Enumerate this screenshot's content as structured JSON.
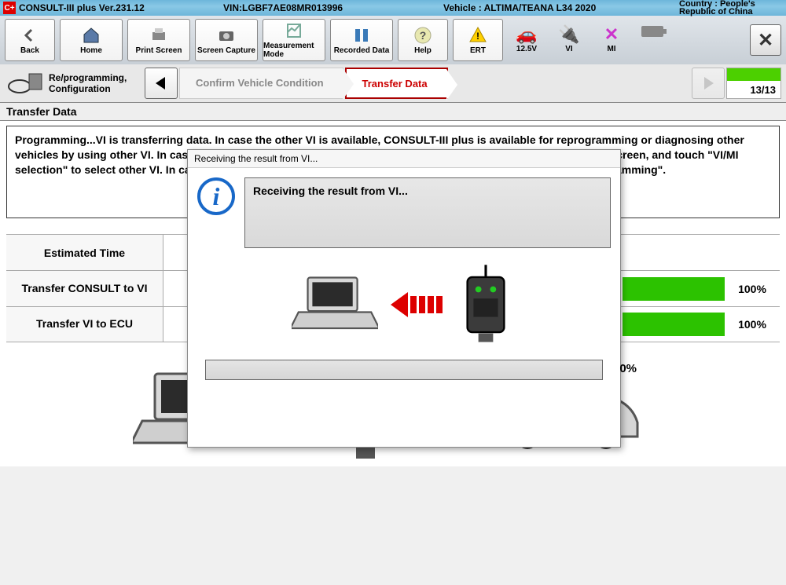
{
  "titlebar": {
    "app": "CONSULT-III plus  Ver.231.12",
    "vin": "VIN:LGBF7AE08MR013996",
    "vehicle": "Vehicle : ALTIMA/TEANA L34 2020",
    "country": "Country : People's Republic of China"
  },
  "toolbar": {
    "back": "Back",
    "home": "Home",
    "print": "Print Screen",
    "capture": "Screen Capture",
    "measure": "Measurement Mode",
    "recorded": "Recorded Data",
    "help": "Help",
    "ert": "ERT",
    "voltage": "12.5V",
    "vi": "VI",
    "mi": "MI"
  },
  "crumbs": {
    "mode": "Re/programming, Configuration",
    "c1": "Confirm Vehicle Condition",
    "c2": "Transfer Data",
    "progress": "13/13"
  },
  "section": {
    "heading": "Transfer Data"
  },
  "info_text": "Programming...VI is transferring data.  In case the other VI is available, CONSULT-III plus is available for reprogramming or diagnosing other vehicles by using other VI. In case you want to use CONSULT-III plus with other VI, touch \"Back\" to back to Home screen, and touch \"VI/MI selection\" to select other VI. In case you want to back to this screen with this VI, and touch \"Reprogramming/Programming\".",
  "rows": {
    "r0": {
      "label": "Estimated Time"
    },
    "r1": {
      "label": "Transfer CONSULT to VI",
      "end": "100%"
    },
    "r2": {
      "label": "Transfer VI to ECU",
      "end": "100%"
    }
  },
  "dialog": {
    "title": "Receiving the result from VI...",
    "message": "Receiving the result from VI...",
    "pct": "0%"
  },
  "icons": {
    "laptop": "laptop-icon",
    "vci": "vci-device-icon",
    "car": "car-icon"
  }
}
